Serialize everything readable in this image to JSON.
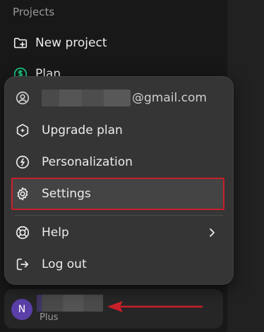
{
  "sidebar": {
    "section_label": "Projects",
    "items": [
      {
        "label": "New project",
        "icon": "folder-plus-icon"
      },
      {
        "label": "Plan",
        "icon": "dollar-circle-icon",
        "accent": "#19c37d"
      }
    ]
  },
  "menu": {
    "email_suffix": "@gmail.com",
    "items": [
      {
        "label": "Upgrade plan",
        "icon": "sparkle-hex-icon"
      },
      {
        "label": "Personalization",
        "icon": "personalization-icon"
      },
      {
        "label": "Settings",
        "icon": "gear-icon"
      },
      {
        "label": "Help",
        "icon": "lifebuoy-icon"
      },
      {
        "label": "Log out",
        "icon": "logout-icon"
      }
    ]
  },
  "user": {
    "avatar_initial": "N",
    "avatar_color": "#5b3fa8",
    "plan": "Plus"
  },
  "annotation": {
    "highlight_color": "#c8202a"
  }
}
